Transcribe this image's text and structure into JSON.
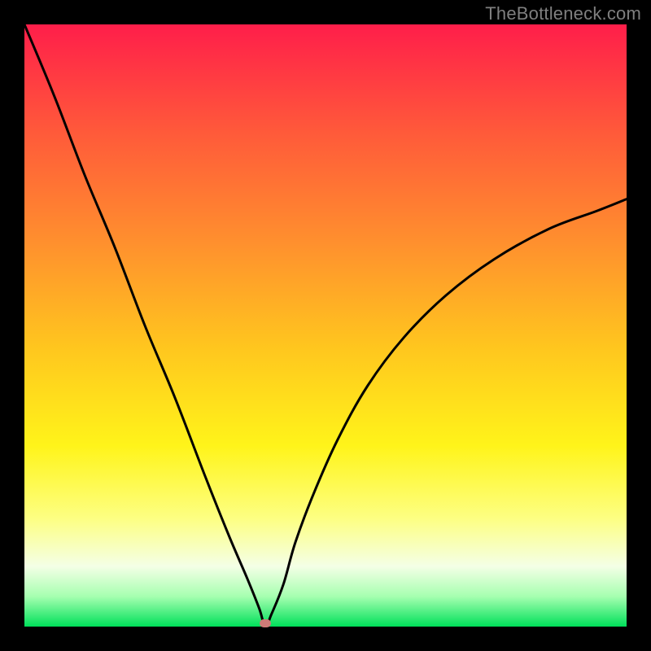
{
  "watermark": "TheBottleneck.com",
  "colors": {
    "frame": "#000000",
    "gradient_top": "#ff1e4a",
    "gradient_bottom": "#00e05a",
    "curve": "#000000",
    "marker": "#cd7b77",
    "watermark": "#7f7f7f"
  },
  "chart_data": {
    "type": "line",
    "title": "",
    "xlabel": "",
    "ylabel": "",
    "xlim": [
      0,
      100
    ],
    "ylim": [
      0,
      100
    ],
    "grid": false,
    "legend": false,
    "marker": {
      "x": 40,
      "y": 0
    },
    "series": [
      {
        "name": "bottleneck-curve",
        "x": [
          0,
          5,
          10,
          15,
          20,
          25,
          30,
          34,
          37,
          39,
          40,
          41,
          43,
          45,
          48,
          52,
          57,
          63,
          70,
          78,
          87,
          95,
          100
        ],
        "values": [
          100,
          88,
          75,
          63,
          50,
          38,
          25,
          15,
          8,
          3,
          0,
          2,
          7,
          14,
          22,
          31,
          40,
          48,
          55,
          61,
          66,
          69,
          71
        ]
      }
    ]
  }
}
